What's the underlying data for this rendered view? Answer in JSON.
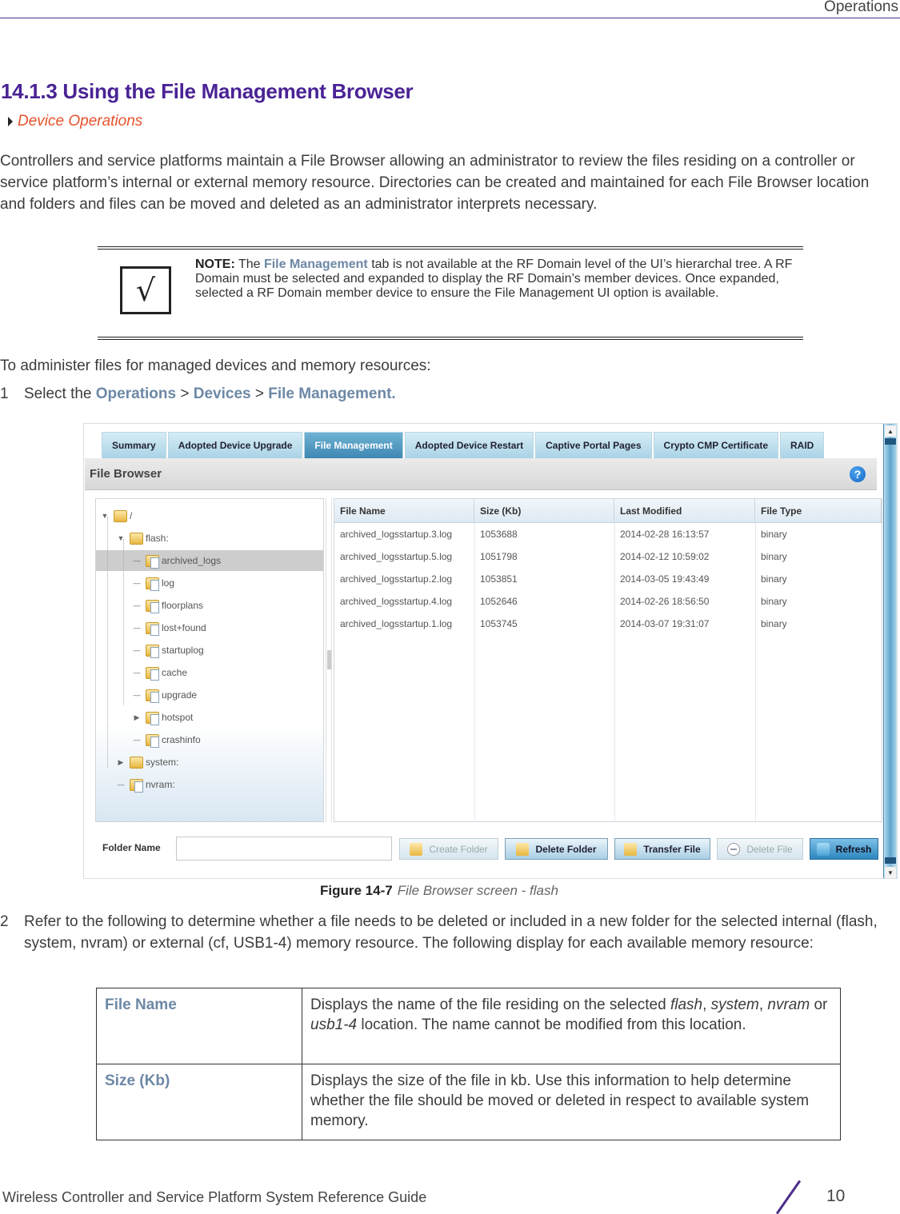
{
  "header": {
    "running_head": "Operations"
  },
  "section": {
    "title": "14.1.3 Using the File Management Browser",
    "breadcrumb": "Device Operations"
  },
  "intro": "Controllers and service platforms maintain a File Browser allowing an administrator to review the files residing on a controller or service platform’s internal or external memory resource. Directories can be created and maintained for each File Browser location and folders and files can be moved and deleted as an administrator interprets necessary.",
  "note": {
    "icon": "checkmark-icon",
    "label": "NOTE:",
    "text_1": " The ",
    "highlight": "File Management",
    "text_2": " tab is not available at the RF Domain level of the UI’s hierarchal tree. A RF Domain must be selected and expanded to display the RF Domain’s member devices. Once expanded, selected a RF Domain member device to ensure the File Management UI option is available."
  },
  "admin_intro": "To administer files for managed devices and memory resources:",
  "step1": {
    "number": "1",
    "prefix": "Select the ",
    "path": [
      "Operations",
      "Devices",
      "File Management."
    ],
    "separator": " > "
  },
  "figure": {
    "tabs": [
      {
        "label": "Summary",
        "active": false
      },
      {
        "label": "Adopted Device Upgrade",
        "active": false
      },
      {
        "label": "File Management",
        "active": true
      },
      {
        "label": "Adopted Device Restart",
        "active": false
      },
      {
        "label": "Captive Portal Pages",
        "active": false
      },
      {
        "label": "Crypto CMP Certificate",
        "active": false
      },
      {
        "label": "RAID",
        "active": false
      }
    ],
    "panel_title": "File Browser",
    "help_icon": "?",
    "tree": [
      {
        "label": "/",
        "level": 0,
        "toggle": "expanded"
      },
      {
        "label": "flash:",
        "level": 1,
        "toggle": "expanded"
      },
      {
        "label": "archived_logs",
        "level": 2,
        "toggle": "none",
        "selected": true
      },
      {
        "label": "log",
        "level": 2,
        "toggle": "none"
      },
      {
        "label": "floorplans",
        "level": 2,
        "toggle": "none"
      },
      {
        "label": "lost+found",
        "level": 2,
        "toggle": "none"
      },
      {
        "label": "startuplog",
        "level": 2,
        "toggle": "none"
      },
      {
        "label": "cache",
        "level": 2,
        "toggle": "none"
      },
      {
        "label": "upgrade",
        "level": 2,
        "toggle": "none"
      },
      {
        "label": "hotspot",
        "level": 2,
        "toggle": "collapsed"
      },
      {
        "label": "crashinfo",
        "level": 2,
        "toggle": "none"
      },
      {
        "label": "system:",
        "level": 1,
        "toggle": "collapsed"
      },
      {
        "label": "nvram:",
        "level": 1,
        "toggle": "none"
      }
    ],
    "columns": [
      "File Name",
      "Size (Kb)",
      "Last Modified",
      "File Type"
    ],
    "rows": [
      [
        "archived_logsstartup.3.log",
        "1053688",
        "2014-02-28 16:13:57",
        "binary"
      ],
      [
        "archived_logsstartup.5.log",
        "1051798",
        "2014-02-12 10:59:02",
        "binary"
      ],
      [
        "archived_logsstartup.2.log",
        "1053851",
        "2014-03-05 19:43:49",
        "binary"
      ],
      [
        "archived_logsstartup.4.log",
        "1052646",
        "2014-02-26 18:56:50",
        "binary"
      ],
      [
        "archived_logsstartup.1.log",
        "1053745",
        "2014-03-07 19:31:07",
        "binary"
      ]
    ],
    "folder_name_label": "Folder Name",
    "folder_name_value": "",
    "buttons": {
      "create_folder": "Create Folder",
      "delete_folder": "Delete Folder",
      "transfer_file": "Transfer File",
      "delete_file": "Delete File",
      "refresh": "Refresh"
    },
    "caption_label": "Figure 14-7",
    "caption_text": "File Browser screen - flash"
  },
  "step2": {
    "number": "2",
    "text": "Refer to the following to determine whether a file needs to be deleted or included in a new folder for the selected internal (flash, system, nvram) or external (cf, USB1-4) memory resource. The following display for each available memory resource:"
  },
  "definitions": [
    {
      "term": "File Name",
      "parts": [
        {
          "t": "Displays the name of the file residing on the selected ",
          "i": false
        },
        {
          "t": "flash",
          "i": true
        },
        {
          "t": ", ",
          "i": false
        },
        {
          "t": "system",
          "i": true
        },
        {
          "t": ", ",
          "i": false
        },
        {
          "t": "nvram",
          "i": true
        },
        {
          "t": " or ",
          "i": false
        },
        {
          "t": "usb1-4",
          "i": true
        },
        {
          "t": " location. The name cannot be modified from this location.",
          "i": false
        }
      ]
    },
    {
      "term": "Size (Kb)",
      "parts": [
        {
          "t": "Displays the size of the file in kb. Use this information to help determine whether the file should be moved or deleted in respect to available system memory.",
          "i": false
        }
      ]
    }
  ],
  "footer": {
    "guide_title": "Wireless Controller and Service Platform System Reference Guide",
    "page_number": "10"
  }
}
